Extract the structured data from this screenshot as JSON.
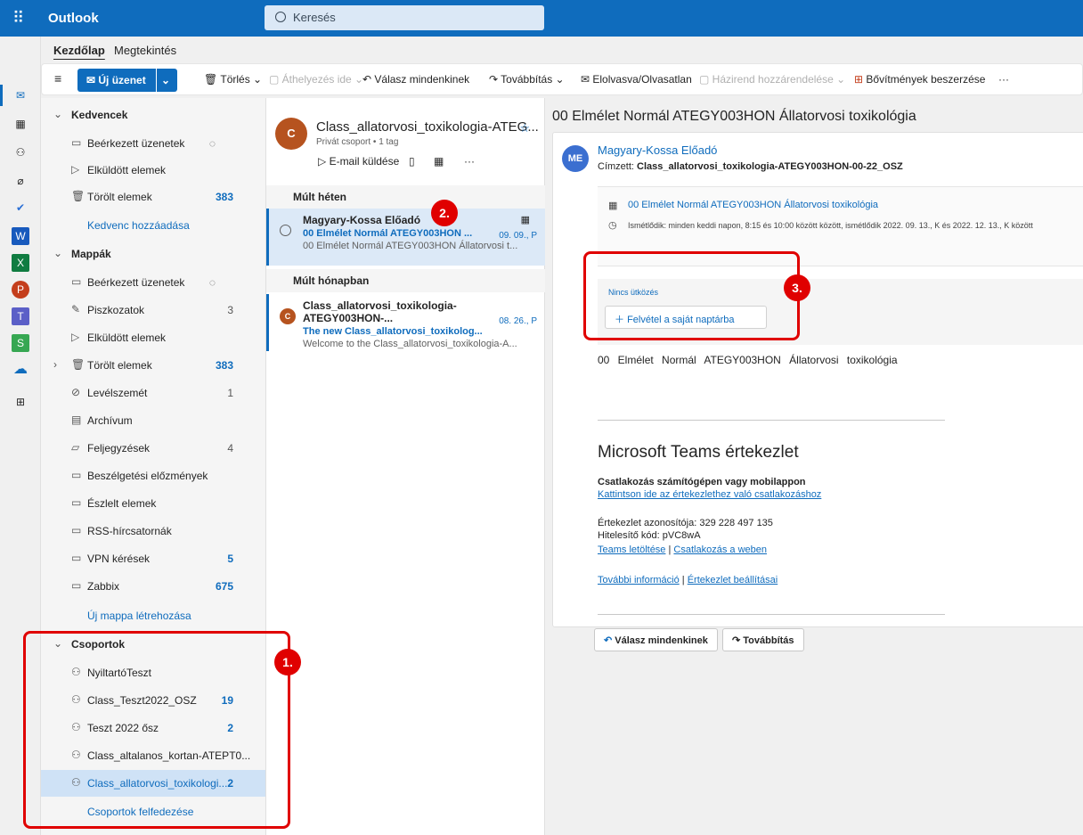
{
  "app": {
    "name": "Outlook",
    "search_placeholder": "Keresés"
  },
  "tabs": [
    "Kezdőlap",
    "Megtekintés"
  ],
  "ribbon": {
    "new_message": "Új üzenet",
    "delete": "Törlés",
    "move": "Áthelyezés ide",
    "reply_all": "Válasz mindenkinek",
    "forward": "Továbbítás",
    "read_unread": "Elolvasva/Olvasatlan",
    "policy": "Házirend hozzárendelése",
    "addins": "Bővítmények beszerzése",
    "more": "···"
  },
  "sidebar": {
    "favorites_title": "Kedvencek",
    "favorites": [
      {
        "label": "Beérkezett üzenetek",
        "count": ""
      },
      {
        "label": "Elküldött elemek",
        "count": ""
      },
      {
        "label": "Törölt elemek",
        "count": "383"
      }
    ],
    "add_favorite": "Kedvenc hozzáadása",
    "folders_title": "Mappák",
    "folders": [
      {
        "label": "Beérkezett üzenetek",
        "count": ""
      },
      {
        "label": "Piszkozatok",
        "count": "3"
      },
      {
        "label": "Elküldött elemek",
        "count": ""
      },
      {
        "label": "Törölt elemek",
        "count": "383"
      },
      {
        "label": "Levélszemét",
        "count": "1"
      },
      {
        "label": "Archívum",
        "count": ""
      },
      {
        "label": "Feljegyzések",
        "count": "4"
      },
      {
        "label": "Beszélgetési előzmények",
        "count": ""
      },
      {
        "label": "Észlelt elemek",
        "count": ""
      },
      {
        "label": "RSS-hírcsatornák",
        "count": ""
      },
      {
        "label": "VPN kérések",
        "count": "5"
      },
      {
        "label": "Zabbix",
        "count": "675"
      }
    ],
    "new_folder": "Új mappa létrehozása",
    "groups_title": "Csoportok",
    "groups": [
      {
        "label": "NyiltartóTeszt",
        "count": ""
      },
      {
        "label": "Class_Teszt2022_OSZ",
        "count": "19"
      },
      {
        "label": "Teszt 2022 ősz",
        "count": "2"
      },
      {
        "label": "Class_altalanos_kortan-ATEPT0...",
        "count": ""
      },
      {
        "label": "Class_allatorvosi_toxikologi...",
        "count": "2"
      }
    ],
    "discover_groups": "Csoportok felfedezése"
  },
  "group_header": {
    "avatar": "C",
    "title": "Class_allatorvosi_toxikologia-ATEG...",
    "subtitle": "Privát csoport • 1 tag",
    "send_email": "E-mail küldése",
    "more": "···"
  },
  "messages": {
    "section1": "Múlt héten",
    "m1": {
      "from": "Magyary-Kossa Előadó",
      "subject": "00 Elmélet Normál ATEGY003HON ...",
      "date": "09. 09., P",
      "preview": "00 Elmélet Normál ATEGY003HON Állatorvosi t..."
    },
    "section2": "Múlt hónapban",
    "m2": {
      "avatar": "C",
      "from": "Class_allatorvosi_toxikologia-ATEGY003HON-...",
      "subject": "The new Class_allatorvosi_toxikolog...",
      "date": "08. 26., P",
      "preview": "Welcome to the Class_allatorvosi_toxikologia-A..."
    }
  },
  "reading": {
    "title": "00 Elmélet Normál ATEGY003HON Állatorvosi toxikológia",
    "avatar": "ME",
    "sender": "Magyary-Kossa Előadó",
    "to_label": "Címzett:",
    "to": "Class_allatorvosi_toxikologia-ATEGY003HON-00-22_OSZ",
    "meeting_title": "00 Elmélet Normál ATEGY003HON Állatorvosi toxikológia",
    "recurrence": "Ismétlődik: minden keddi napon, 8:15 és 10:00 között között, ismétlődik 2022. 09. 13., K és 2022. 12. 13., K között",
    "no_conflict": "Nincs ütközés",
    "add_calendar": "Felvétel a saját naptárba",
    "body": "00 Elmélet Normál ATEGY003HON Állatorvosi toxikológia",
    "teams_title": "Microsoft Teams értekezlet",
    "join_title": "Csatlakozás számítógépen vagy mobilappon",
    "join_link": "Kattintson ide az értekezlethez való csatlakozáshoz",
    "meeting_id": "Értekezlet azonosítója: 329 228 497 135",
    "passcode": "Hitelesítő kód: pVC8wA",
    "download": "Teams letöltése",
    "sep": "|",
    "web": "Csatlakozás a weben",
    "more_info": "További információ",
    "settings": "Értekezlet beállításai",
    "reply_all": "Válasz mindenkinek",
    "forward": "Továbbítás"
  },
  "annotations": [
    "1.",
    "2.",
    "3."
  ],
  "colors": {
    "accent": "#0f6cbd",
    "annotation": "#e00000",
    "avatar": "#b6531f"
  }
}
